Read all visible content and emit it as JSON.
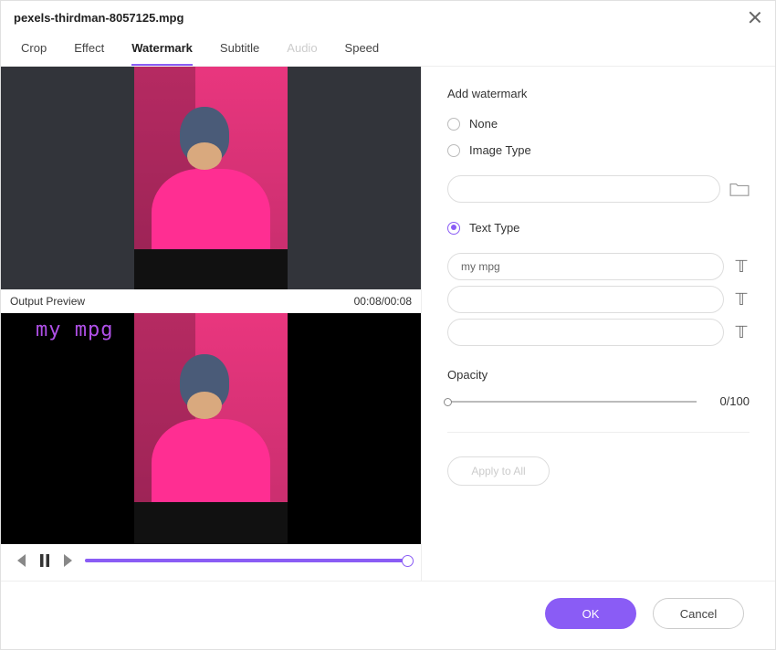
{
  "titlebar": {
    "title": "pexels-thirdman-8057125.mpg"
  },
  "tabs": [
    {
      "label": "Crop",
      "state": "normal"
    },
    {
      "label": "Effect",
      "state": "normal"
    },
    {
      "label": "Watermark",
      "state": "active"
    },
    {
      "label": "Subtitle",
      "state": "normal"
    },
    {
      "label": "Audio",
      "state": "disabled"
    },
    {
      "label": "Speed",
      "state": "normal"
    }
  ],
  "preview": {
    "output_label": "Output Preview",
    "time": "00:08/00:08",
    "watermark_text": "my mpg"
  },
  "panel": {
    "title": "Add watermark",
    "options": {
      "none": {
        "label": "None",
        "selected": false
      },
      "image": {
        "label": "Image Type",
        "selected": false,
        "path": ""
      },
      "text": {
        "label": "Text Type",
        "selected": true,
        "line1": "my mpg",
        "line2": "",
        "line3": ""
      }
    },
    "opacity": {
      "label": "Opacity",
      "value": 0,
      "display": "0/100"
    },
    "apply_all": "Apply to All"
  },
  "footer": {
    "ok": "OK",
    "cancel": "Cancel"
  },
  "icons": {
    "close": "close-icon",
    "folder": "folder-icon",
    "text_style": "text-style-icon",
    "prev": "prev-icon",
    "pause": "pause-icon",
    "next": "next-icon"
  }
}
